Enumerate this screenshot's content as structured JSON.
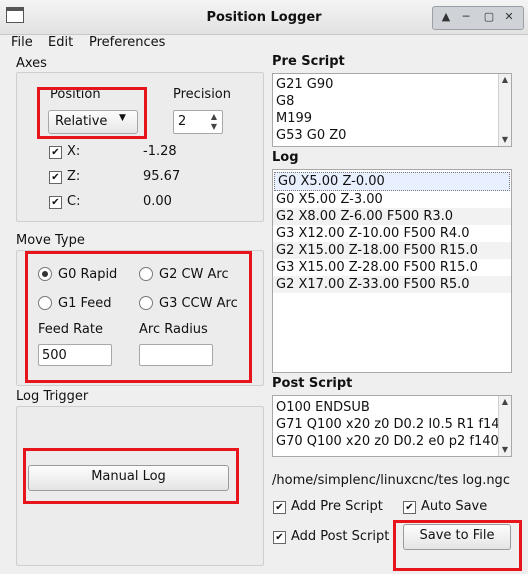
{
  "window": {
    "title": "Position Logger"
  },
  "menu": [
    "File",
    "Edit",
    "Preferences"
  ],
  "axes": {
    "group_title": "Axes",
    "position_label": "Position",
    "position_value": "Relative",
    "precision_label": "Precision",
    "precision_value": "2",
    "rows": [
      {
        "name": "X:",
        "checked": true,
        "value": "-1.28"
      },
      {
        "name": "Z:",
        "checked": true,
        "value": "95.67"
      },
      {
        "name": "C:",
        "checked": true,
        "value": "0.00"
      }
    ]
  },
  "move_type": {
    "group_title": "Move Type",
    "options": [
      "G0 Rapid",
      "G2 CW Arc",
      "G1 Feed",
      "G3 CCW Arc"
    ],
    "selected": "G0 Rapid",
    "feed_rate_label": "Feed Rate",
    "feed_rate_value": "500",
    "arc_radius_label": "Arc Radius",
    "arc_radius_value": ""
  },
  "log_trigger": {
    "group_title": "Log Trigger",
    "manual_log_label": "Manual Log"
  },
  "pre_script": {
    "title": "Pre Script",
    "lines": [
      "G21 G90",
      "G8",
      "M199",
      "G53 G0 Z0"
    ]
  },
  "log": {
    "title": "Log",
    "lines": [
      "G0 X5.00 Z-0.00",
      "G0 X5.00 Z-3.00",
      "G2 X8.00 Z-6.00 F500 R3.0",
      "G3 X12.00 Z-10.00 F500 R4.0",
      "G2 X15.00 Z-18.00 F500 R15.0",
      "G3 X15.00 Z-28.00 F500 R15.0",
      "G2 X17.00 Z-33.00 F500 R5.0"
    ]
  },
  "post_script": {
    "title": "Post Script",
    "lines": [
      "O100 ENDSUB",
      "G71 Q100 x20 z0 D0.2 I0.5 R1 f14",
      "G70 Q100 x20 z0 D0.2 e0 p2 f140"
    ]
  },
  "file_path": "/home/simplenc/linuxcnc/tes log.ngc",
  "options": {
    "add_pre_script": {
      "label": "Add Pre Script",
      "checked": true
    },
    "auto_save": {
      "label": "Auto Save",
      "checked": true
    },
    "add_post_script": {
      "label": "Add Post Script",
      "checked": true
    }
  },
  "save_button_label": "Save to File",
  "colors": {
    "highlight": "#e8141c",
    "log_selection": "#e8f0ff"
  }
}
